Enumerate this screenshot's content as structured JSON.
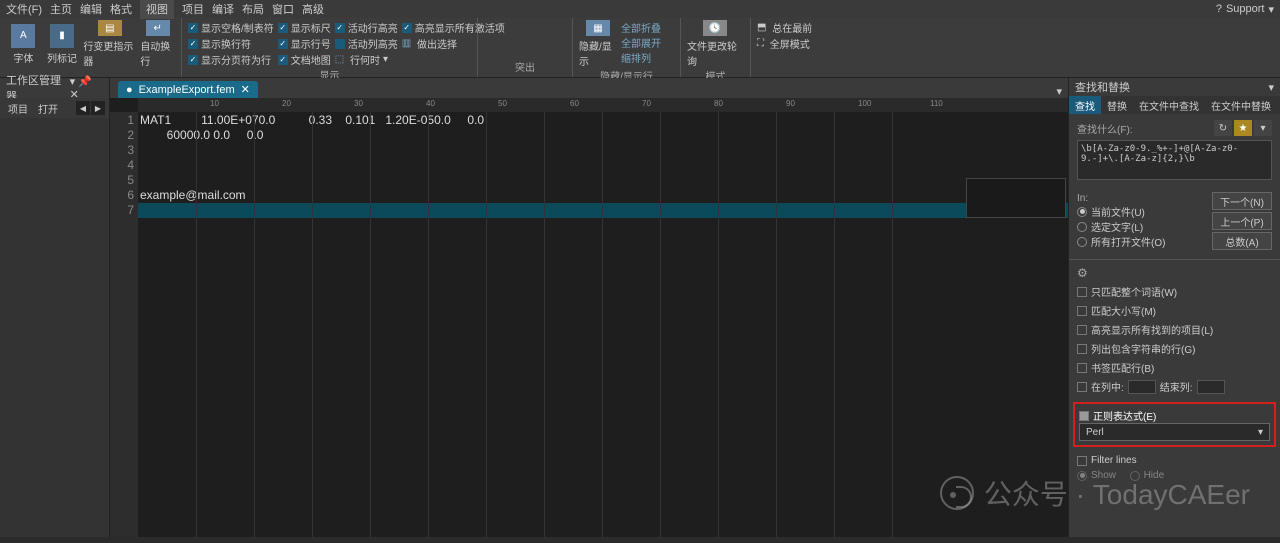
{
  "menu": {
    "items": [
      "文件(F)",
      "主页",
      "编辑",
      "格式",
      "视图",
      "项目",
      "编译",
      "布局",
      "窗口",
      "高级"
    ],
    "active_index": 4,
    "support": "Support"
  },
  "ribbon": {
    "group1": {
      "btn1": "字体",
      "btn2": "列标记",
      "btn3": "行变更指示器",
      "btn4": "自动换行"
    },
    "group2": {
      "row1": [
        "显示空格/制表符",
        "显示标尺",
        "活动行高亮",
        "高亮显示所有激活项"
      ],
      "row2": [
        "显示换行符",
        "显示行号",
        "活动列高亮",
        "做出选择"
      ],
      "row3": [
        "显示分页符为行",
        "文档地图",
        "行何时"
      ],
      "label": "显示"
    },
    "group3": {
      "btn": "隐藏/显示",
      "link1": "全部折叠",
      "link2": "全部展开",
      "link3": "缩排列",
      "label": "隐藏/显示行"
    },
    "group4": {
      "btn": "文件更改轮询",
      "label": "模式"
    },
    "group5": {
      "opt1": "总在最前",
      "opt2": "全屏模式"
    },
    "highlight_label": "突出"
  },
  "leftPanel": {
    "title": "工作区管理器",
    "tab1": "项目",
    "tab2": "打开"
  },
  "tabs": {
    "file": "ExampleExport.fem"
  },
  "ruler": {
    "marks": [
      "10",
      "20",
      "30",
      "40",
      "50",
      "60",
      "70",
      "80",
      "90",
      "100",
      "110"
    ]
  },
  "code": {
    "lines": [
      "MAT1         11.00E+070.0          0.33    0.101   1.20E-050.0     0.0",
      "        60000.0 0.0     0.0",
      "",
      "",
      "",
      "example@mail.com",
      ""
    ],
    "highlight_row": 7
  },
  "rightPanel": {
    "title": "查找和替换",
    "tabs": [
      "查找",
      "替换",
      "在文件中查找",
      "在文件中替换"
    ],
    "active_tab": 0,
    "search_label": "查找什么(F):",
    "search_value": "\\b[A-Za-z0-9._%+-]+@[A-Za-z0-9.-]+\\.[A-Za-z]{2,}\\b",
    "in_label": "In:",
    "radio1": "当前文件(U)",
    "radio2": "选定文字(L)",
    "radio3": "所有打开文件(O)",
    "btn_next": "下一个(N)",
    "btn_prev": "上一个(P)",
    "btn_count": "总数(A)",
    "opt1": "只匹配整个词语(W)",
    "opt2": "匹配大小写(M)",
    "opt3": "高亮显示所有找到的项目(L)",
    "opt4": "列出包含字符串的行(G)",
    "opt5": "书签匹配行(B)",
    "opt6_a": "在列中:",
    "opt6_b": "结束列:",
    "regex_label": "正则表达式(E)",
    "dropdown": "Perl",
    "filter": "Filter lines",
    "show": "Show",
    "hide": "Hide"
  },
  "watermark": {
    "text": "公众号 · TodayCAEer"
  }
}
